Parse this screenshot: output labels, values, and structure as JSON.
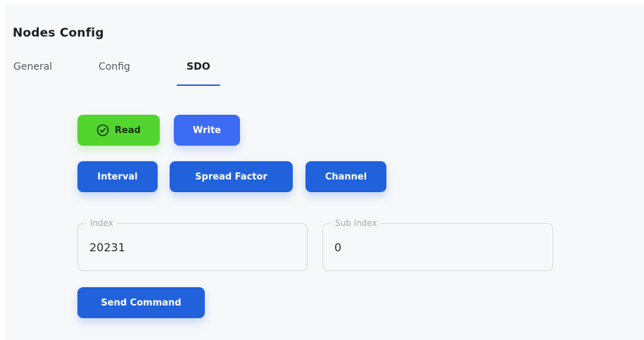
{
  "page": {
    "title": "Nodes Config"
  },
  "tabs": [
    {
      "label": "General",
      "active": false
    },
    {
      "label": "Config",
      "active": false
    },
    {
      "label": "SDO",
      "active": true
    }
  ],
  "mode_buttons": {
    "read_label": "Read",
    "write_label": "Write",
    "read_selected": true
  },
  "parameter_buttons": {
    "interval_label": "Interval",
    "spread_factor_label": "Spread Factor",
    "channel_label": "Channel"
  },
  "fields": {
    "index": {
      "label": "Index",
      "value": "20231"
    },
    "sub_index": {
      "label": "Sub Index",
      "value": "0"
    }
  },
  "actions": {
    "send_command_label": "Send Command"
  },
  "colors": {
    "primary": "#2162dc",
    "write": "#3c6cf4",
    "read_selected": "#53d52f",
    "tab_indicator": "#2a5ee0"
  },
  "icons": {
    "read_button_icon": "check-circle-icon"
  }
}
